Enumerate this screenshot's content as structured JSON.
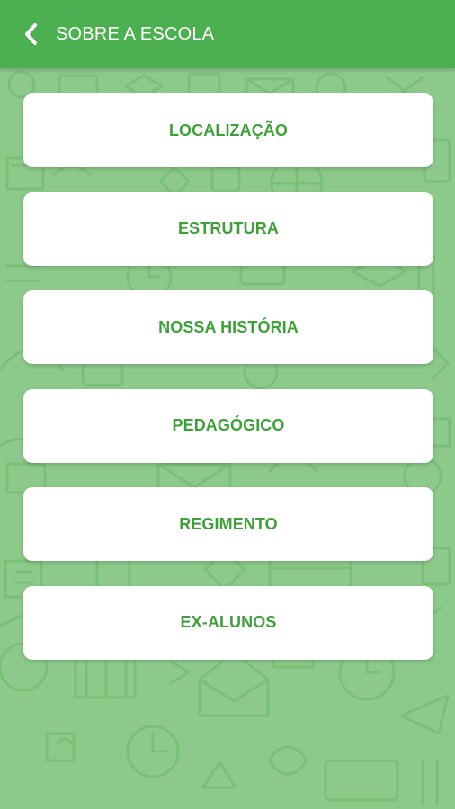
{
  "header": {
    "title": "SOBRE A ESCOLA",
    "back_icon": "chevron-left-icon"
  },
  "colors": {
    "app_bar": "#4caf50",
    "background": "#8cc98a",
    "pattern_stroke": "#7abf78",
    "card": "#ffffff",
    "label": "#3f9f3b"
  },
  "menu": {
    "items": [
      {
        "label": "LOCALIZAÇÃO"
      },
      {
        "label": "ESTRUTURA"
      },
      {
        "label": "NOSSA HISTÓRIA"
      },
      {
        "label": "PEDAGÓGICO"
      },
      {
        "label": "REGIMENTO"
      },
      {
        "label": "EX-ALUNOS"
      }
    ]
  }
}
